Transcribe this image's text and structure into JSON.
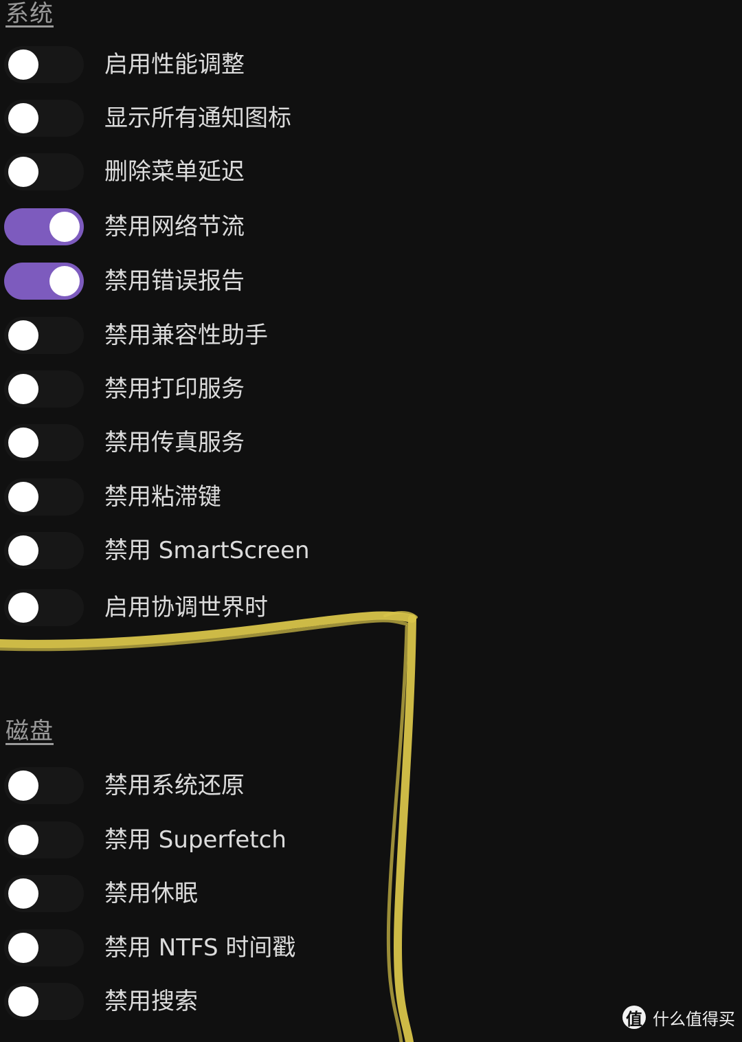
{
  "sections": [
    {
      "title": "系统",
      "items": [
        {
          "label": "启用性能调整",
          "on": false
        },
        {
          "label": "显示所有通知图标",
          "on": false
        },
        {
          "label": "删除菜单延迟",
          "on": false
        },
        {
          "label": "禁用网络节流",
          "on": true
        },
        {
          "label": "禁用错误报告",
          "on": true
        },
        {
          "label": "禁用兼容性助手",
          "on": false
        },
        {
          "label": "禁用打印服务",
          "on": false
        },
        {
          "label": "禁用传真服务",
          "on": false
        },
        {
          "label": "禁用粘滞键",
          "on": false
        },
        {
          "label": "禁用 SmartScreen",
          "on": false
        },
        {
          "label": "启用协调世界时",
          "on": false
        }
      ]
    },
    {
      "title": "磁盘",
      "items": [
        {
          "label": "禁用系统还原",
          "on": false
        },
        {
          "label": "禁用 Superfetch",
          "on": false
        },
        {
          "label": "禁用休眠",
          "on": false
        },
        {
          "label": "禁用 NTFS 时间戳",
          "on": false
        },
        {
          "label": "禁用搜索",
          "on": false
        }
      ]
    }
  ],
  "colors": {
    "background": "#101010",
    "toggle_on": "#7d5bbe",
    "toggle_off": "#171717",
    "knob": "#ffffff",
    "highlight_marker": "#d8c44a"
  },
  "watermark": {
    "logo_text": "值",
    "text": "什么值得买"
  }
}
